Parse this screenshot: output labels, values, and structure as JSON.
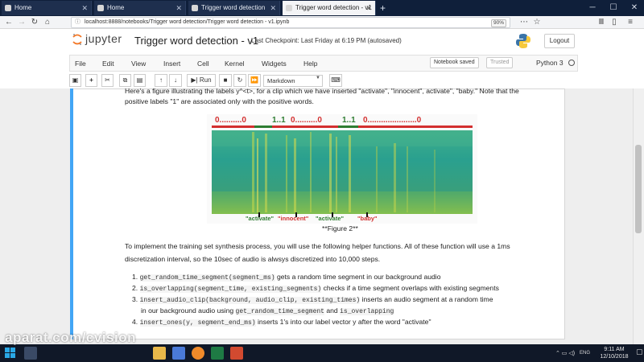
{
  "browser": {
    "tabs": [
      {
        "label": "Home",
        "active": false
      },
      {
        "label": "Home",
        "active": false
      },
      {
        "label": "Trigger word detection",
        "active": false
      },
      {
        "label": "Trigger word detection - v1",
        "active": true
      }
    ],
    "new_tab_label": "+",
    "url": "localhost:8888/notebooks/Trigger word detection/Trigger word detection - v1.ipynb",
    "zoom": "90%"
  },
  "jupyter": {
    "logo_text": "jupyter",
    "notebook_title": "Trigger word detection - v1",
    "checkpoint": "Last Checkpoint: Last Friday at 6:19 PM  (autosaved)",
    "logout_label": "Logout",
    "menu": [
      "File",
      "Edit",
      "View",
      "Insert",
      "Cell",
      "Kernel",
      "Widgets",
      "Help"
    ],
    "notebook_saved": "Notebook saved",
    "trusted": "Trusted",
    "kernel_name": "Python 3",
    "toolbar": {
      "run_label": "Run",
      "cell_type": "Markdown"
    }
  },
  "cell": {
    "intro_line1": "Here's a figure illustrating the labels y^<t>, for a clip which we have inserted \"activate\", \"innocent\", activate\", \"baby.\" Note that the",
    "intro_line2": "positive labels \"1\" are associated only with the positive words.",
    "figure": {
      "label_segments": [
        "0..........0",
        "1..1",
        "0..........0",
        "1..1",
        "0......................0"
      ],
      "word_labels": [
        "\"activate\"",
        "\"innocent\"",
        "\"activate\"",
        "\"baby\""
      ],
      "caption": "**Figure 2**"
    },
    "para_line1": "To implement the training set synthesis process, you will use the following helper functions. All of these function will use a 1ms",
    "para_line2": "discretization interval, so the 10sec of audio is alwsys discretized into 10,000 steps.",
    "list": [
      {
        "num": "1.",
        "code": "get_random_time_segment(segment_ms)",
        "text": "gets a random time segment in our background audio"
      },
      {
        "num": "2.",
        "code": "is_overlapping(segment_time, existing_segments)",
        "text": "checks if a time segment overlaps with existing segments"
      },
      {
        "num": "3.",
        "code": "insert_audio_clip(background, audio_clip, existing_times)",
        "text": "inserts an audio segment at a random time",
        "line2_pre": "in our background audio using",
        "code2": "get_random_time_segment",
        "line2_mid": "and",
        "code3": "is_overlapping"
      },
      {
        "num": "4.",
        "code": "insert_ones(y, segment_end_ms)",
        "text": "inserts 1's into our label vector y after the word \"activate\""
      }
    ]
  },
  "taskbar": {
    "watermark": "aparat.com/cvision",
    "lang": "ENG",
    "time": "9:11 AM",
    "date": "12/10/2018"
  },
  "colors": {
    "tab_strip": "#0f1f3a",
    "cell_selected_bar": "#42a5f5",
    "label_zero": "#d32f2f",
    "label_one": "#2e7d32",
    "taskbar": "#101828"
  }
}
